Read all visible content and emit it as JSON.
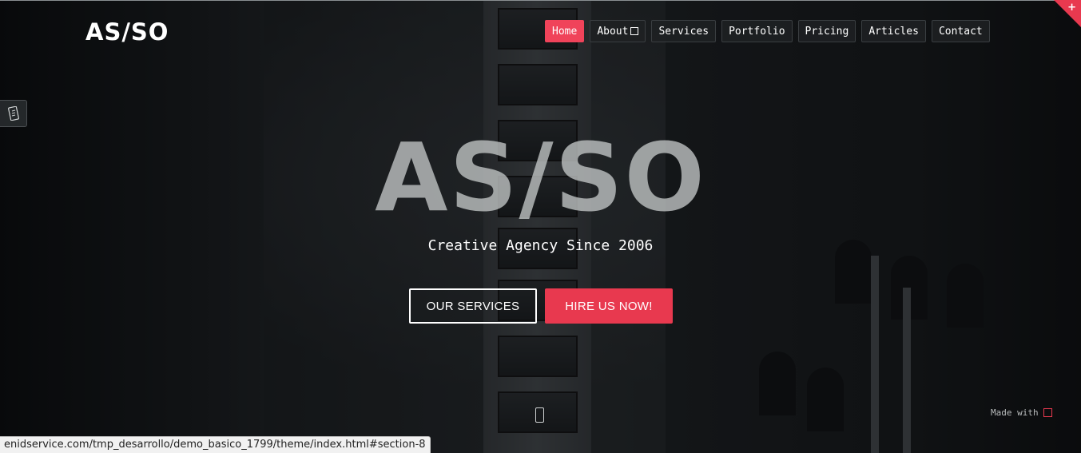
{
  "logo": {
    "text": "AS/SO"
  },
  "nav": {
    "items": [
      {
        "label": "Home",
        "active": true
      },
      {
        "label": "About",
        "has_dropdown": true
      },
      {
        "label": "Services"
      },
      {
        "label": "Portfolio"
      },
      {
        "label": "Pricing"
      },
      {
        "label": "Articles"
      },
      {
        "label": "Contact"
      }
    ]
  },
  "hero": {
    "title": "AS/SO",
    "subtitle": "Creative Agency Since 2006",
    "primary_button": "OUR SERVICES",
    "secondary_button": "HIRE US NOW!"
  },
  "corner": {
    "icon": "plus-icon",
    "symbol": "+"
  },
  "side_widget": {
    "icon": "mobile-icon"
  },
  "scroll": {
    "icon": "scroll-down-icon"
  },
  "footer": {
    "made_with": "Made with",
    "heart_icon": "heart-icon"
  },
  "status_bar": {
    "url": "enidservice.com/tmp_desarrollo/demo_basico_1799/theme/index.html#section-8"
  },
  "colors": {
    "accent": "#e8394f",
    "nav_active": "#f0435a",
    "text": "#ffffff",
    "background": "#0f1214"
  }
}
